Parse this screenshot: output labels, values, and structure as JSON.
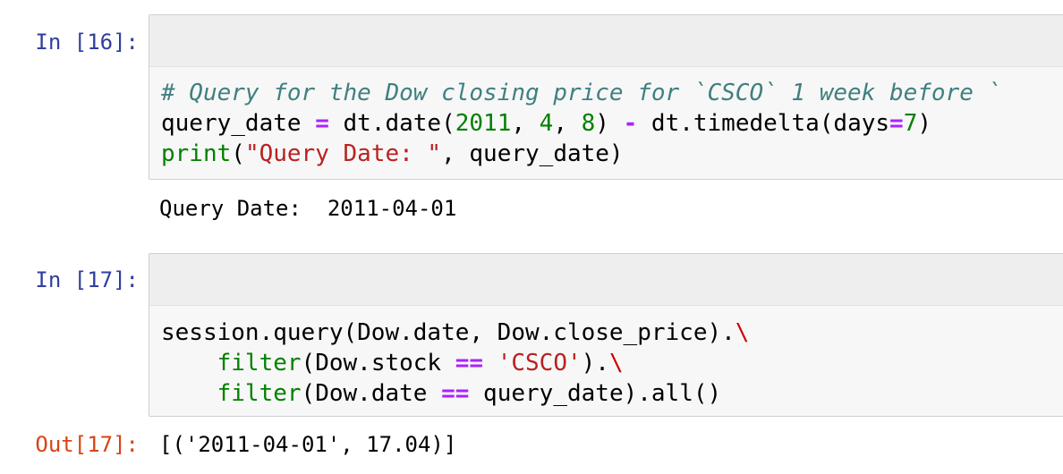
{
  "cells": [
    {
      "prompt": "In [16]:",
      "tokens": {
        "comment": "# Query for the Dow closing price for `CSCO` 1 week before `",
        "line2_var": "query_date ",
        "line2_eq": "=",
        "line2_call": " dt.date(",
        "line2_n1": "2011",
        "line2_c1": ", ",
        "line2_n2": "4",
        "line2_c2": ", ",
        "line2_n3": "8",
        "line2_close": ") ",
        "line2_minus": "-",
        "line2_td": " dt.timedelta(days",
        "line2_eq2": "=",
        "line2_n4": "7",
        "line2_end": ")",
        "line3_print": "print",
        "line3_open": "(",
        "line3_str": "\"Query Date: \"",
        "line3_rest": ", query_date)"
      },
      "output": "Query Date:  2011-04-01"
    },
    {
      "prompt": "In [17]:",
      "tokens": {
        "line1": "session.query(Dow.date, Dow.close_price).",
        "line1_cont": "\\",
        "line2_indent": "    ",
        "line2_filter": "filter",
        "line2_mid": "(Dow.stock ",
        "line2_eq": "==",
        "line2_sp": " ",
        "line2_str": "'CSCO'",
        "line2_end": ").",
        "line2_cont": "\\",
        "line3_indent": "    ",
        "line3_filter": "filter",
        "line3_mid": "(Dow.date ",
        "line3_eq": "==",
        "line3_rest": " query_date).all()"
      },
      "out_prompt": "Out[17]:",
      "output": "[('2011-04-01', 17.04)]"
    }
  ]
}
